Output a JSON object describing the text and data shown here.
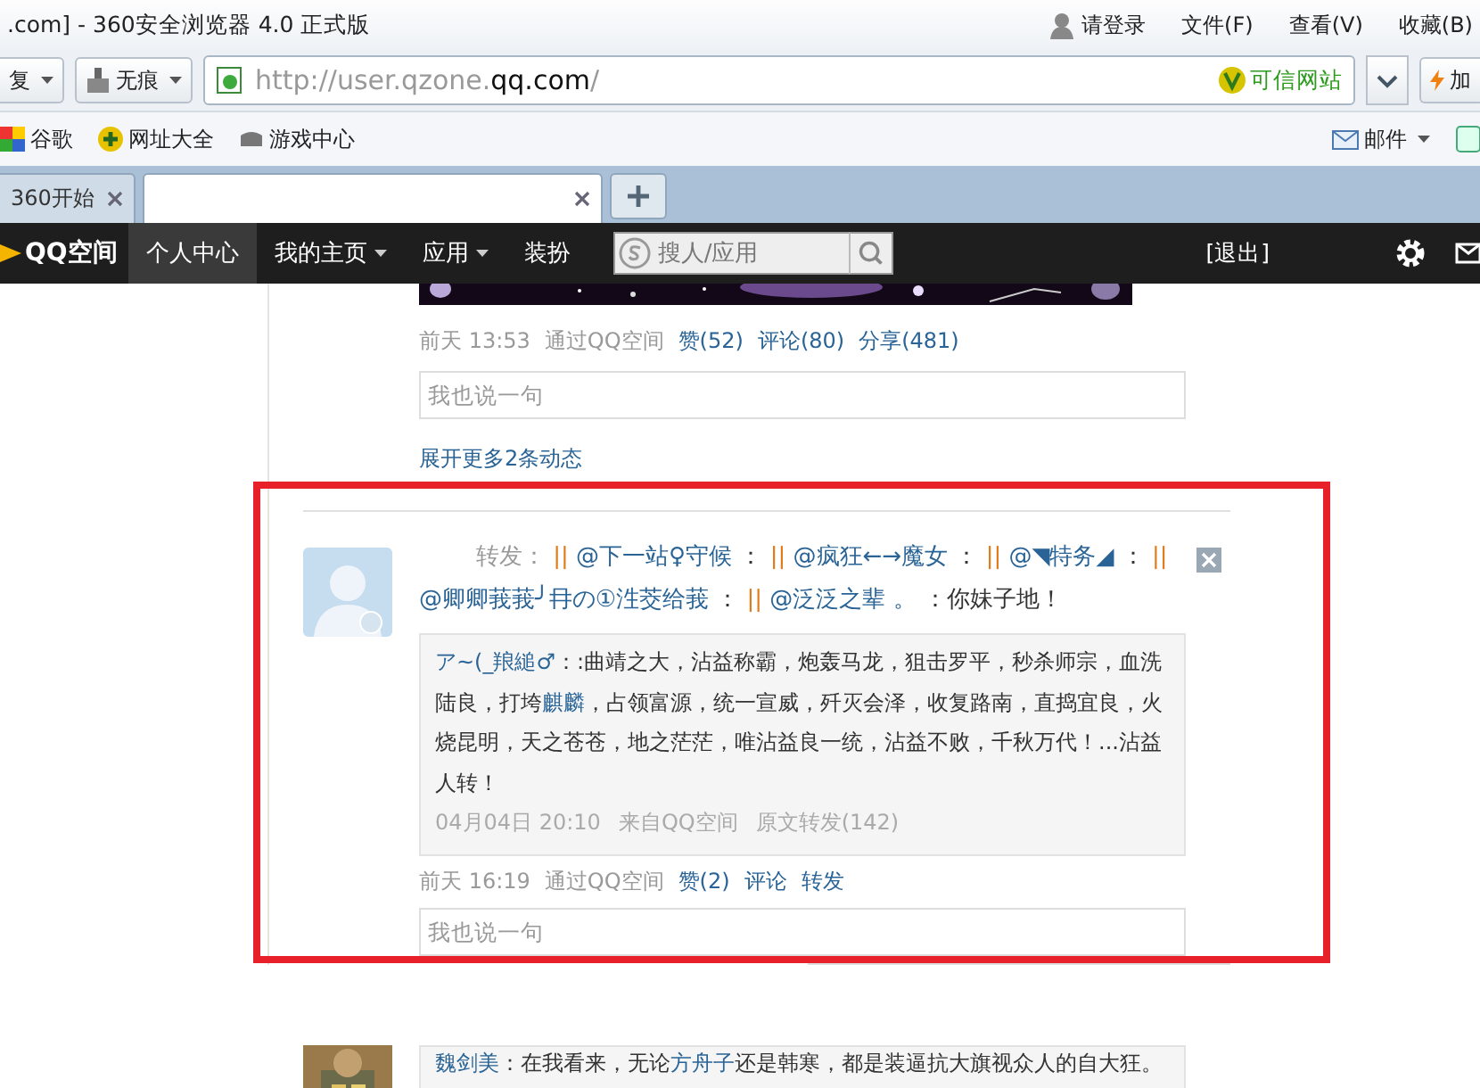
{
  "browser": {
    "title": ".com] - 360安全浏览器 4.0 正式版",
    "menu": [
      "请登录",
      "文件(F)",
      "查看(V)",
      "收藏(B)"
    ],
    "toolbar": {
      "restore": "复",
      "incognito": "无痕",
      "address": {
        "prefix": "http://user.qzone.",
        "domain": "qq.com",
        "suffix": "/"
      },
      "trust_badge": "可信网站",
      "add": "加"
    },
    "bookmarks": [
      "谷歌",
      "网址大全",
      "游戏中心"
    ],
    "mail": "邮件",
    "tabs": [
      {
        "label": "360开始",
        "selected": false
      },
      {
        "selected": true
      }
    ]
  },
  "nav": {
    "logo": "QQ空间",
    "items": [
      {
        "label": "个人中心",
        "selected": true,
        "dropdown": false
      },
      {
        "label": "我的主页",
        "selected": false,
        "dropdown": true
      },
      {
        "label": "应用",
        "selected": false,
        "dropdown": true
      },
      {
        "label": "装扮",
        "selected": false,
        "dropdown": false
      }
    ],
    "search": {
      "placeholder": "搜人/应用"
    },
    "logout": "[退出]"
  },
  "feed": [
    {
      "kind": "post",
      "highlighted": false,
      "time": "前天 13:53",
      "via": "通过QQ空间",
      "actions": [
        "赞(52)",
        "评论(80)",
        "分享(481)"
      ],
      "comment": {
        "placeholder": "我也说一句"
      },
      "expand": "展开更多2条动态"
    },
    {
      "kind": "repost",
      "highlighted": true,
      "segments": [
        {
          "kind": "label",
          "text": "转发： "
        },
        {
          "kind": "bar",
          "text": "|| "
        },
        {
          "kind": "mention",
          "text": "@下一站♀守候"
        },
        {
          "kind": "plain",
          "text": " ： "
        },
        {
          "kind": "bar",
          "text": "|| "
        },
        {
          "kind": "mention",
          "text": "@疯狂←→魔女"
        },
        {
          "kind": "plain",
          "text": " ： "
        },
        {
          "kind": "bar",
          "text": "|| "
        },
        {
          "kind": "mention",
          "text": "@◥特务◢"
        },
        {
          "kind": "plain",
          "text": " ： "
        },
        {
          "kind": "bar",
          "text": "|| "
        },
        {
          "kind": "mention",
          "text": "@卿卿莪莪╯冄の①泩茭给莪"
        },
        {
          "kind": "plain",
          "text": " ： "
        },
        {
          "kind": "bar",
          "text": "|| "
        },
        {
          "kind": "mention",
          "text": "@泛泛之辈 。"
        },
        {
          "kind": "plain",
          "text": " ：你妹子地！"
        }
      ],
      "quote": {
        "author": "ア~(_羪縋♂",
        "segments": [
          {
            "kind": "plain",
            "text": "：:曲靖之大，沾益称霸，炮轰马龙，狙击罗平，秒杀师宗，血洗陆良，打垮"
          },
          {
            "kind": "mention",
            "text": "麒麟"
          },
          {
            "kind": "plain",
            "text": "，占领富源，统一宣威，歼灭会泽，收复路南，直捣宜良，火烧昆明，天之苍苍，地之茫茫，唯沾益良一统，沾益不败，千秋万代！...沾益人转！"
          }
        ],
        "time": "04月04日 20:10",
        "via": "来自QQ空间",
        "forwards": "原文转发(142)"
      },
      "time": "前天 16:19",
      "via": "通过QQ空间",
      "actions": [
        "赞(2)",
        "评论",
        "转发"
      ],
      "comment": {
        "placeholder": "我也说一句"
      }
    },
    {
      "kind": "quote_only",
      "highlighted": false,
      "quote": {
        "author": "魏剑美",
        "segments": [
          {
            "kind": "plain",
            "text": "：在我看来，无论"
          },
          {
            "kind": "mention",
            "text": "方舟子"
          },
          {
            "kind": "plain",
            "text": "还是韩寒，都是装逼抗大旗视众人的自大狂。"
          }
        ]
      }
    }
  ]
}
